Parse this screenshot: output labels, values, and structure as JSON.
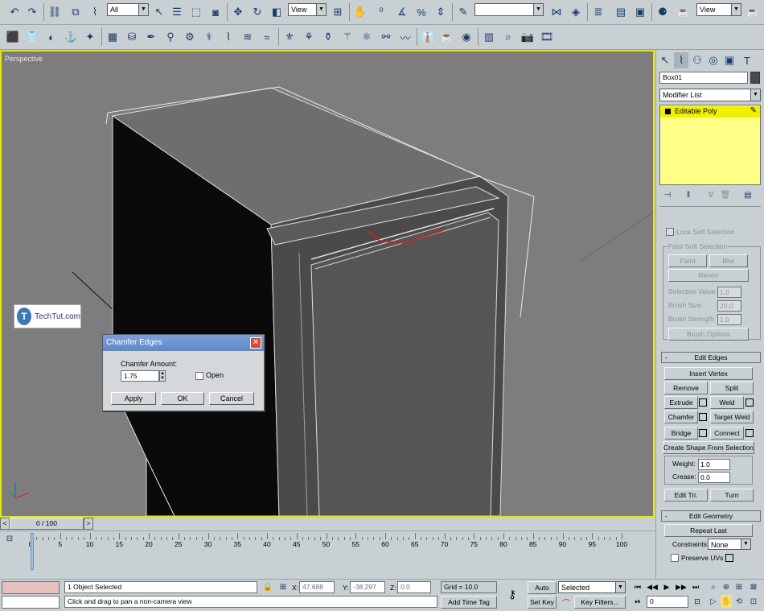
{
  "toolbar": {
    "selection_filter": "All",
    "ref_coord": "View",
    "named_selection": "",
    "ref_coord2": "View"
  },
  "viewport": {
    "label": "Perspective"
  },
  "watermark": {
    "text": "TechTut.com"
  },
  "dialog": {
    "title": "Chamfer Edges",
    "amount_label": "Chamfer Amount:",
    "amount_value": "1.75",
    "open_label": "Open",
    "apply_label": "Apply",
    "ok_label": "OK",
    "cancel_label": "Cancel"
  },
  "command_panel": {
    "object_name": "Box01",
    "modifier_list": "Modifier List",
    "stack_item": "Editable Poly",
    "soft_selection": {
      "lock_label": "Lock Soft Selection",
      "paint_group": "Paint Soft Selection",
      "paint": "Paint",
      "blur": "Blur",
      "revert": "Revert",
      "sel_value_label": "Selection Value",
      "sel_value": "1.0",
      "brush_size_label": "Brush Size",
      "brush_size": "20.0",
      "brush_strength_label": "Brush Strength",
      "brush_strength": "1.0",
      "brush_options": "Brush Options"
    },
    "edit_edges": {
      "title": "Edit Edges",
      "insert_vertex": "Insert Vertex",
      "remove": "Remove",
      "split": "Split",
      "extrude": "Extrude",
      "weld": "Weld",
      "chamfer": "Chamfer",
      "target_weld": "Target Weld",
      "bridge": "Bridge",
      "connect": "Connect",
      "create_shape": "Create Shape From Selection",
      "weight_label": "Weight:",
      "weight": "1.0",
      "crease_label": "Crease:",
      "crease": "0.0",
      "edit_tri": "Edit Tri.",
      "turn": "Turn"
    },
    "edit_geometry": {
      "title": "Edit Geometry",
      "repeat_last": "Repeat Last",
      "constraints_label": "Constraints:",
      "constraints": "None",
      "preserve_uvs": "Preserve UVs"
    }
  },
  "timeline": {
    "frame": "0 / 100",
    "ticks": [
      "0",
      "5",
      "10",
      "15",
      "20",
      "25",
      "30",
      "35",
      "40",
      "45",
      "50",
      "55",
      "60",
      "65",
      "70",
      "75",
      "80",
      "85",
      "90",
      "95",
      "100"
    ]
  },
  "status": {
    "selected": "1 Object Selected",
    "prompt": "Click and drag to pan a non-camera view",
    "x_label": "X:",
    "x": "47.688",
    "y_label": "Y:",
    "y": "-38.297",
    "z_label": "Z:",
    "z": "0.0",
    "grid": "Grid = 10.0",
    "add_time_tag": "Add Time Tag",
    "auto_key": "Auto Key",
    "set_key": "Set Key",
    "selected_set": "Selected",
    "key_filters": "Key Filters...",
    "current_frame": "0"
  }
}
